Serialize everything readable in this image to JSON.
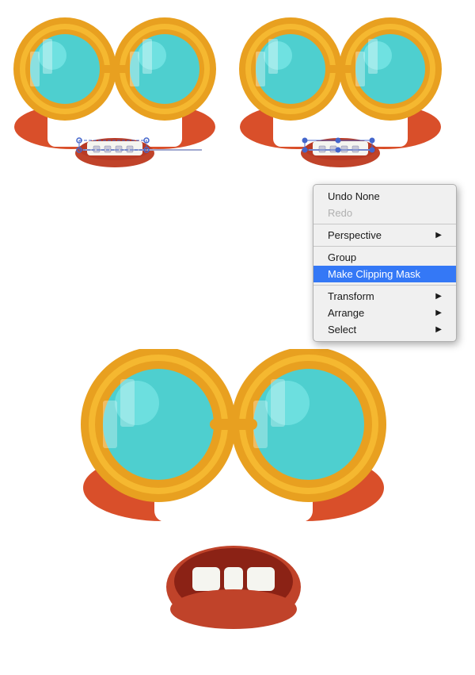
{
  "menu": {
    "items": [
      {
        "id": "undo",
        "label": "Undo None",
        "disabled": false,
        "has_arrow": false
      },
      {
        "id": "redo",
        "label": "Redo",
        "disabled": true,
        "has_arrow": false
      },
      {
        "id": "sep1",
        "type": "separator"
      },
      {
        "id": "perspective",
        "label": "Perspective",
        "disabled": false,
        "has_arrow": true
      },
      {
        "id": "sep2",
        "type": "separator"
      },
      {
        "id": "group",
        "label": "Group",
        "disabled": false,
        "has_arrow": false
      },
      {
        "id": "clipping-mask",
        "label": "Make Clipping Mask",
        "disabled": false,
        "highlighted": true,
        "has_arrow": false
      },
      {
        "id": "sep3",
        "type": "separator"
      },
      {
        "id": "transform",
        "label": "Transform",
        "disabled": false,
        "has_arrow": true
      },
      {
        "id": "arrange",
        "label": "Arrange",
        "disabled": false,
        "has_arrow": true
      },
      {
        "id": "select",
        "label": "Select",
        "disabled": false,
        "has_arrow": true
      }
    ]
  },
  "colors": {
    "glasses_ring_outer": "#E8A020",
    "glasses_ring_inner": "#F5B830",
    "lens_bg": "#4ECFCF",
    "lens_highlight": "#7DE8E8",
    "lens_dark": "#2AABAB",
    "mustache": "#D94F2A",
    "mouth_outer": "#C0432A",
    "mouth_inner": "#B83A25",
    "teeth": "#F5F5F0",
    "braces_wire": "#A0A8D0",
    "skin": "#E06040"
  }
}
